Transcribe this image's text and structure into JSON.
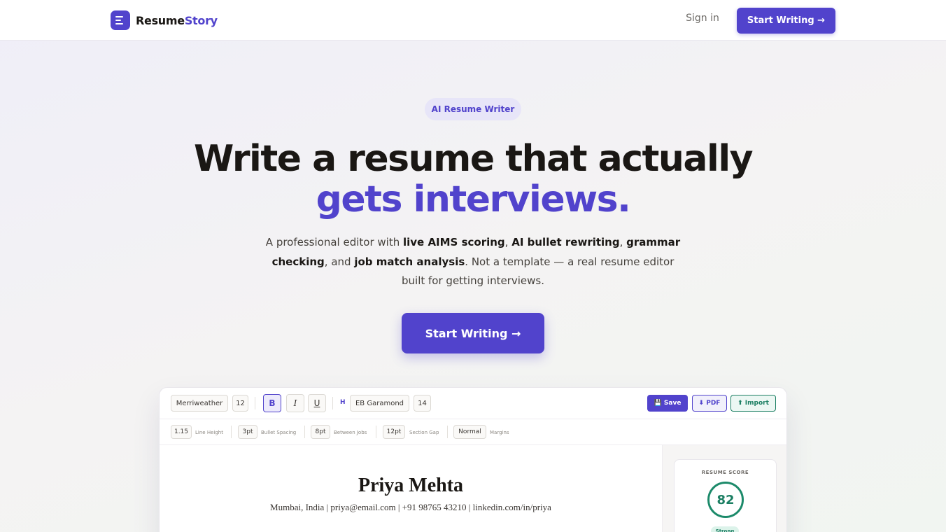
{
  "nav": {
    "brand_a": "Resume",
    "brand_b": "Story",
    "signin": "Sign in",
    "cta": "Start Writing →"
  },
  "hero": {
    "badge": "AI Resume Writer",
    "headline_1": "Write a resume that actually",
    "headline_2": "gets interviews.",
    "sub": {
      "t1": "A professional editor with ",
      "b1": "live AIMS scoring",
      "t2": ", ",
      "b2": "AI bullet rewriting",
      "t3": ", ",
      "b3": "grammar checking",
      "t4": ", and ",
      "b4": "job match analysis",
      "t5": ". Not a template — a real resume editor built for getting interviews."
    },
    "cta": "Start Writing →"
  },
  "editor": {
    "toolbar": {
      "body_font": "Merriweather",
      "body_size": "12",
      "bold": "B",
      "italic": "I",
      "underline": "U",
      "heading_marker": "H",
      "heading_font": "EB Garamond",
      "heading_size": "14",
      "save": "💾 Save",
      "pdf": "⬇ PDF",
      "import": "⬆ Import"
    },
    "spacing": {
      "line_height": "1.15",
      "line_height_label": "Line Height",
      "bullet_spacing": "3pt",
      "bullet_spacing_label": "Bullet Spacing",
      "between_jobs": "8pt",
      "between_jobs_label": "Between Jobs",
      "section_gap": "12pt",
      "section_gap_label": "Section Gap",
      "margins": "Normal",
      "margins_label": "Margins"
    },
    "resume": {
      "name": "Priya Mehta",
      "contact": "Mumbai, India  |  priya@email.com  |  +91 98765 43210  |  linkedin.com/in/priya"
    },
    "score": {
      "label": "RESUME SCORE",
      "value": "82",
      "rating": "Strong"
    }
  },
  "colors": {
    "accent": "#5143cc",
    "success": "#1c7f63"
  }
}
